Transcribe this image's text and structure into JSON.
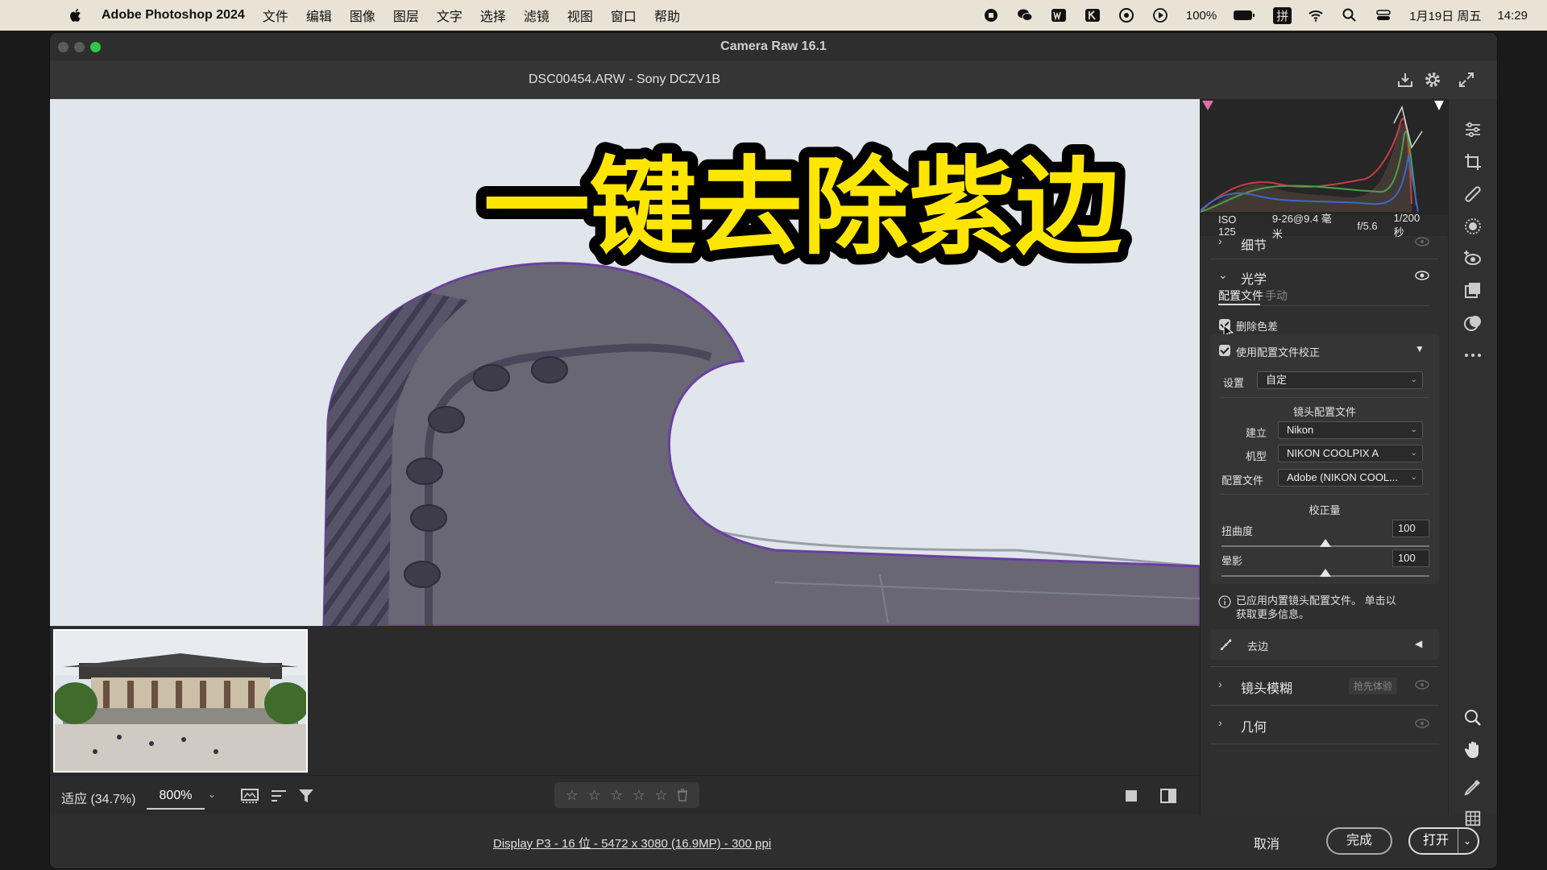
{
  "menubar": {
    "app_name": "Adobe Photoshop 2024",
    "items": [
      "文件",
      "编辑",
      "图像",
      "图层",
      "文字",
      "选择",
      "滤镜",
      "视图",
      "窗口",
      "帮助"
    ],
    "battery": "100%",
    "input_method": "拼",
    "date": "1月19日 周五",
    "time": "14:29",
    "tray_icons": [
      "record-icon",
      "wechat-icon",
      "w-app-icon",
      "k-app-icon",
      "cloud-icon",
      "play-icon",
      "battery-icon",
      "input-method-icon",
      "wifi-icon",
      "search-icon",
      "control-center-icon"
    ]
  },
  "window": {
    "title": "Camera Raw 16.1",
    "file_header": "DSC00454.ARW -  Sony DCZV1B"
  },
  "overlay": {
    "title": "一键去除紫边"
  },
  "camera_info": {
    "iso": "ISO 125",
    "lens": "9-26@9.4 毫米",
    "aperture": "f/5.6",
    "shutter": "1/200 秒"
  },
  "panel": {
    "detail_label": "细节",
    "optics_label": "光学",
    "tab_profile": "配置文件",
    "tab_manual": "手动",
    "remove_ca_label": "删除色差",
    "use_profile_label": "使用配置文件校正",
    "setup_label": "设置",
    "setup_value": "自定",
    "lens_profile_heading": "镜头配置文件",
    "make_label": "建立",
    "make_value": "Nikon",
    "model_label": "机型",
    "model_value": "NIKON COOLPIX A",
    "profile_label": "配置文件",
    "profile_value": "Adobe (NIKON COOL...",
    "amount_heading": "校正量",
    "distortion_label": "扭曲度",
    "distortion_value": "100",
    "distortion_level": 100,
    "vignetting_label": "晕影",
    "vignetting_value": "100",
    "vignetting_level": 100,
    "info_text_1": "已应用内置镜头配置文件。 单击以",
    "info_text_2": "获取更多信息。",
    "defringe_label": "去边",
    "lens_blur_label": "镜头模糊",
    "lens_blur_badge": "抢先体验",
    "geometry_label": "几何"
  },
  "bottom_toolbar": {
    "fit_label": "适应 (34.7%)",
    "zoom_value": "800%",
    "stars": [
      "☆",
      "☆",
      "☆",
      "☆",
      "☆"
    ]
  },
  "footer": {
    "info_link": "Display P3 - 16 位 - 5472 x 3080 (16.9MP) - 300 ppi",
    "cancel_label": "取消",
    "done_label": "完成",
    "open_label": "打开"
  },
  "tools": [
    "edit-sliders-icon",
    "crop-icon",
    "heal-brush-icon",
    "mask-icon",
    "red-eye-icon",
    "snapshots-icon",
    "presets-icon",
    "more-icon",
    "zoom-icon",
    "hand-icon",
    "color-sampler-icon",
    "grid-icon"
  ],
  "colors": {
    "overlay_text": "#ffe600",
    "overlay_stroke": "#000000",
    "done_green": "#2fc744"
  }
}
